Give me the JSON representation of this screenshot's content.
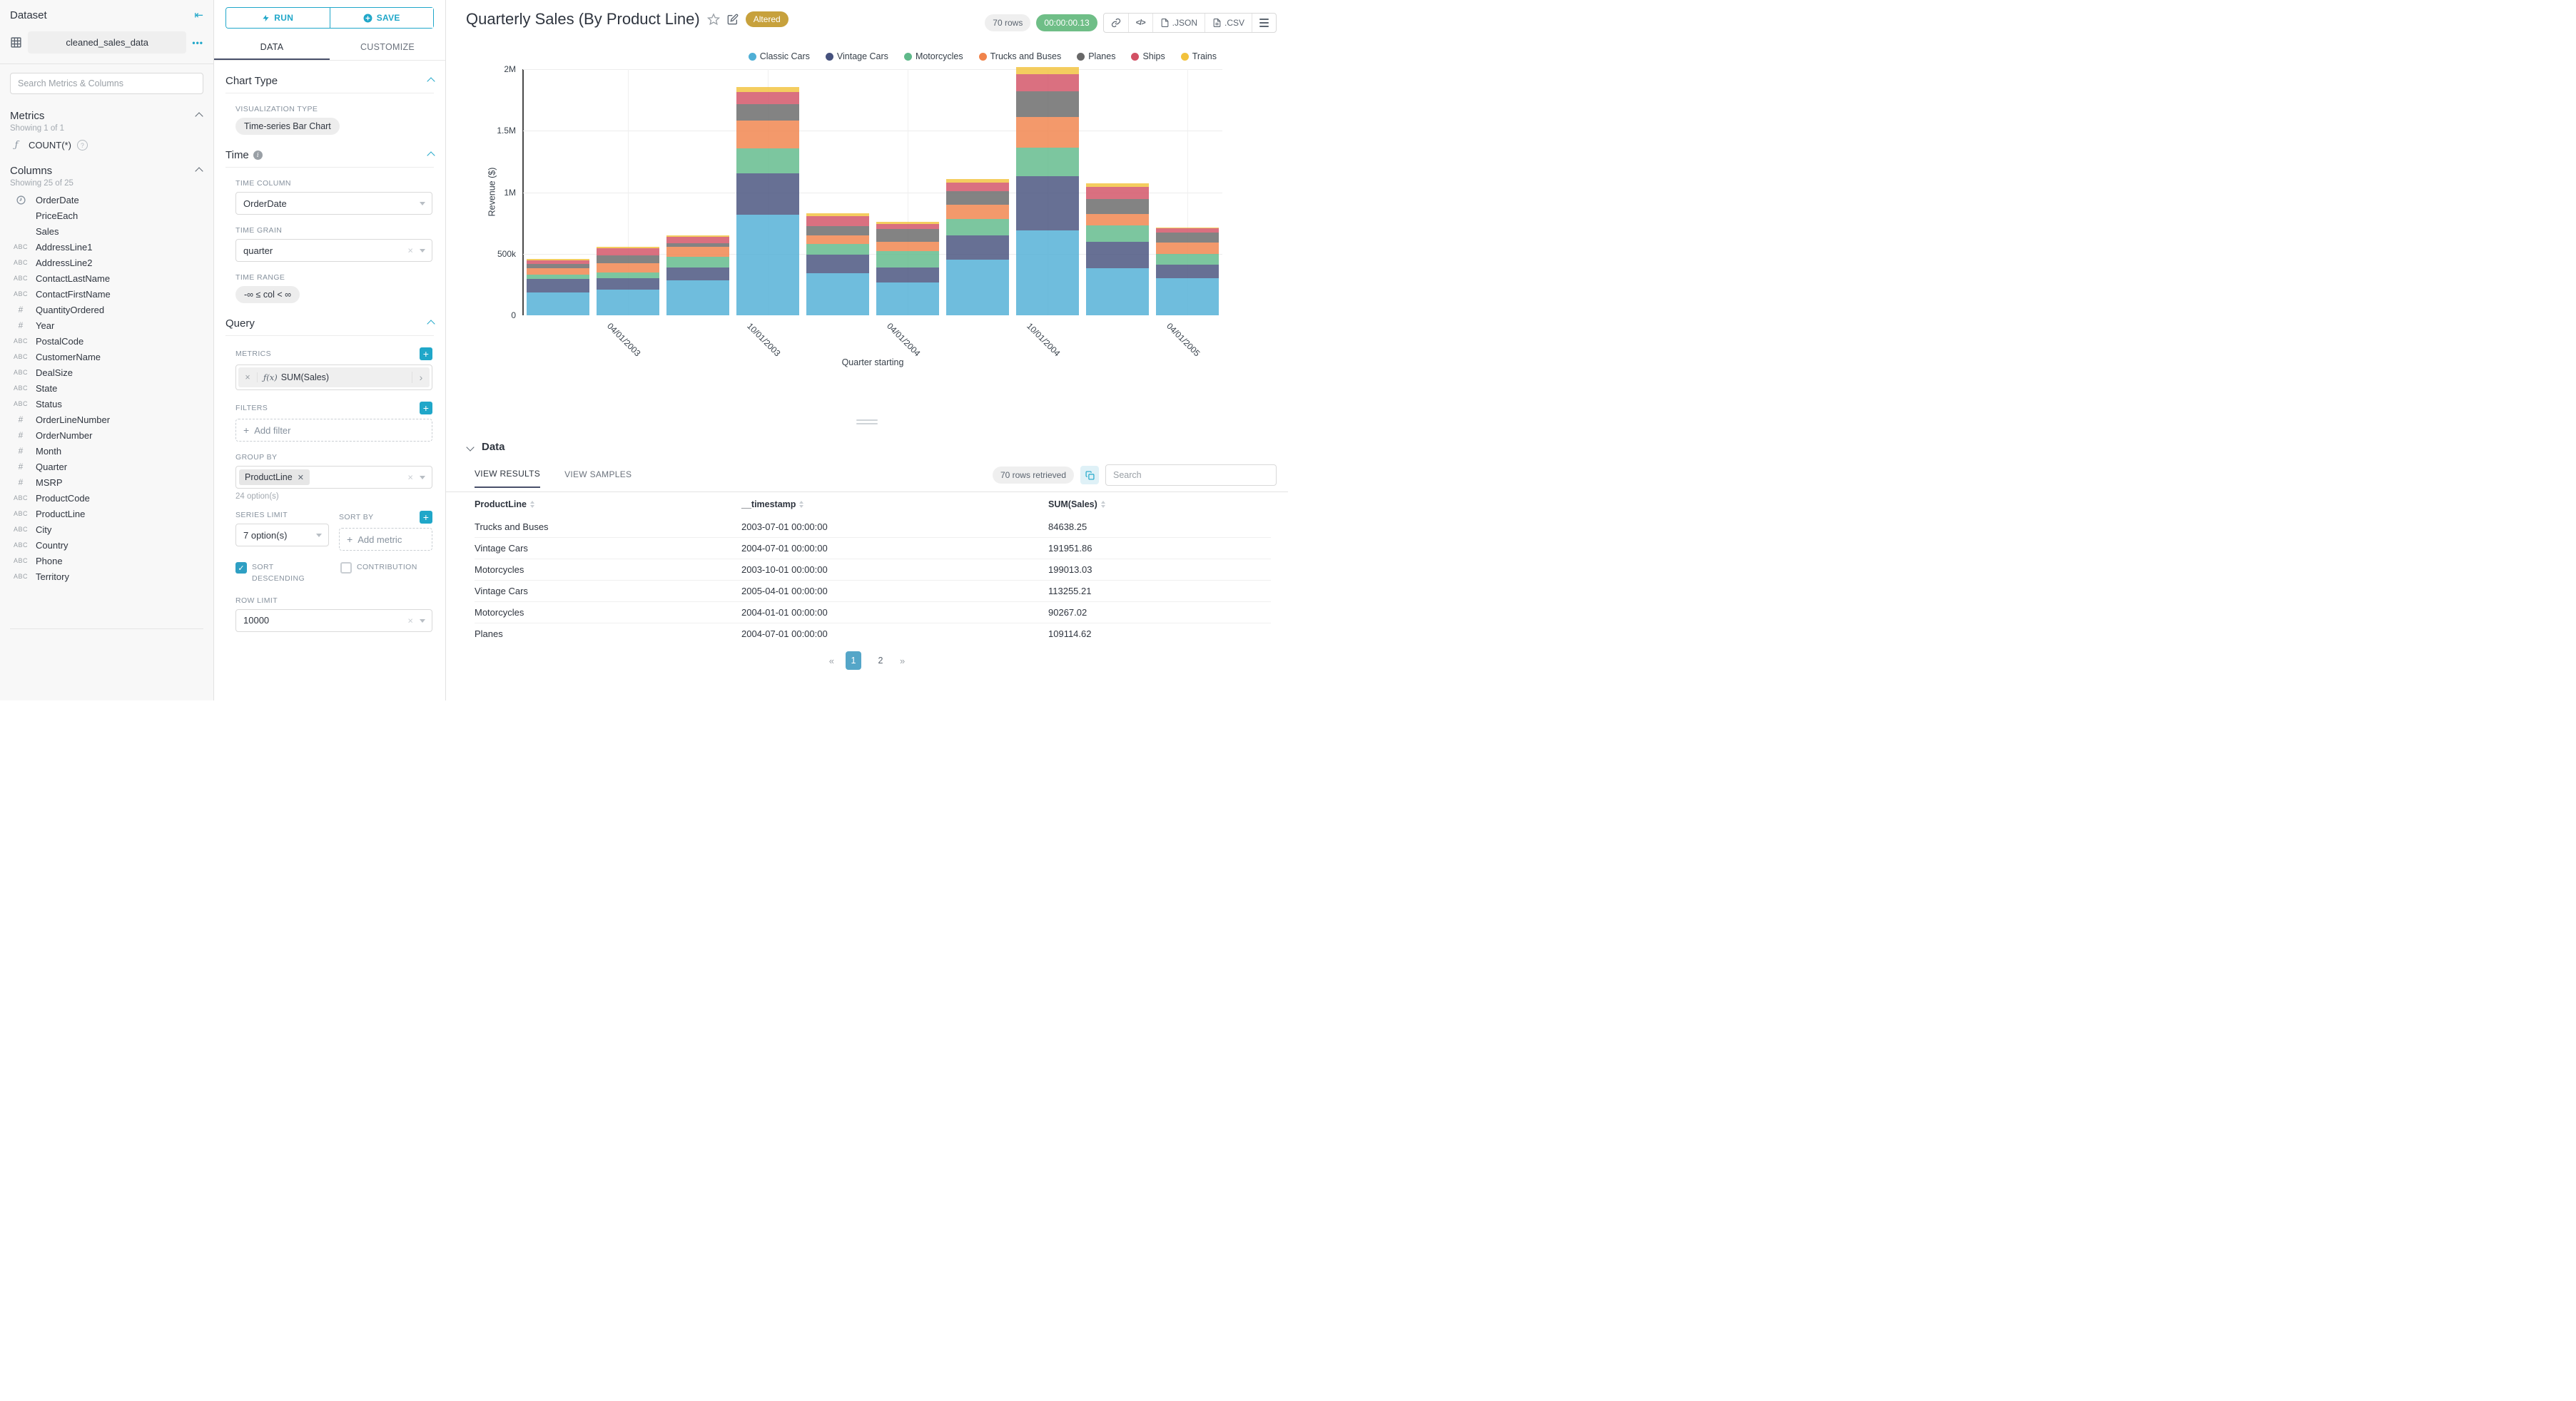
{
  "colors": {
    "accent_teal": "#20a7c9",
    "tab_underline": "#484f69",
    "altered_badge": "#c7a13c",
    "runtime_badge": "#6fbe87",
    "active_page": "#55a6c8",
    "sidebar_bg": "#f8f8f8"
  },
  "sidebar": {
    "title": "Dataset",
    "dataset_name": "cleaned_sales_data",
    "menu_dots": "•••",
    "search_placeholder": "Search Metrics & Columns",
    "metrics_header": "Metrics",
    "metrics_count": "Showing 1 of 1",
    "metric_fx": "ƒ",
    "metric_name": "COUNT(*)",
    "columns_header": "Columns",
    "columns_count": "Showing 25 of 25",
    "type_icons": {
      "text": "ABC",
      "num": "#"
    },
    "columns": [
      {
        "name": "OrderDate",
        "type": "time"
      },
      {
        "name": "PriceEach",
        "type": "none"
      },
      {
        "name": "Sales",
        "type": "none"
      },
      {
        "name": "AddressLine1",
        "type": "text"
      },
      {
        "name": "AddressLine2",
        "type": "text"
      },
      {
        "name": "ContactLastName",
        "type": "text"
      },
      {
        "name": "ContactFirstName",
        "type": "text"
      },
      {
        "name": "QuantityOrdered",
        "type": "num"
      },
      {
        "name": "Year",
        "type": "num"
      },
      {
        "name": "PostalCode",
        "type": "text"
      },
      {
        "name": "CustomerName",
        "type": "text"
      },
      {
        "name": "DealSize",
        "type": "text"
      },
      {
        "name": "State",
        "type": "text"
      },
      {
        "name": "Status",
        "type": "text"
      },
      {
        "name": "OrderLineNumber",
        "type": "num"
      },
      {
        "name": "OrderNumber",
        "type": "num"
      },
      {
        "name": "Month",
        "type": "num"
      },
      {
        "name": "Quarter",
        "type": "num"
      },
      {
        "name": "MSRP",
        "type": "num"
      },
      {
        "name": "ProductCode",
        "type": "text"
      },
      {
        "name": "ProductLine",
        "type": "text"
      },
      {
        "name": "City",
        "type": "text"
      },
      {
        "name": "Country",
        "type": "text"
      },
      {
        "name": "Phone",
        "type": "text"
      },
      {
        "name": "Territory",
        "type": "text"
      }
    ]
  },
  "panel": {
    "run_label": "RUN",
    "save_label": "SAVE",
    "tab_data": "DATA",
    "tab_customize": "CUSTOMIZE",
    "chart_type_header": "Chart Type",
    "visualization_type_label": "VISUALIZATION TYPE",
    "visualization_type": "Time-series Bar Chart",
    "time_header": "Time",
    "time_column_label": "TIME COLUMN",
    "time_column": "OrderDate",
    "time_grain_label": "TIME GRAIN",
    "time_grain": "quarter",
    "time_range_label": "TIME RANGE",
    "time_range": "-∞ ≤ col < ∞",
    "query_header": "Query",
    "metrics_label": "METRICS",
    "metric_prefix": "ƒ(x)",
    "metric_pill": "SUM(Sales)",
    "filters_label": "FILTERS",
    "add_filter": "Add filter",
    "group_by_label": "GROUP BY",
    "group_by_value": "ProductLine",
    "group_by_options": "24 option(s)",
    "series_limit_label": "SERIES LIMIT",
    "series_limit": "7 option(s)",
    "sort_by_label": "SORT BY",
    "add_metric": "Add metric",
    "sort_descending_label": "SORT DESCENDING",
    "contribution_label": "CONTRIBUTION",
    "row_limit_label": "ROW LIMIT",
    "row_limit": "10000"
  },
  "header": {
    "title": "Quarterly Sales (By Product Line)",
    "altered_badge": "Altered",
    "rows_badge": "70 rows",
    "runtime_badge": "00:00:00.13",
    "export_json": ".JSON",
    "export_csv": ".CSV"
  },
  "chart_data": {
    "type": "bar",
    "stacked": true,
    "title": "Quarterly Sales (By Product Line)",
    "xlabel": "Quarter starting",
    "ylabel": "Revenue ($)",
    "ylim": [
      0,
      2000000
    ],
    "y_ticks": [
      "0",
      "500k",
      "1M",
      "1.5M",
      "2M"
    ],
    "grid": true,
    "legend_position": "top-right",
    "x": [
      "2003-01-01",
      "2003-04-01",
      "2003-07-01",
      "2003-10-01",
      "2004-01-01",
      "2004-04-01",
      "2004-07-01",
      "2004-10-01",
      "2005-01-01",
      "2005-04-01"
    ],
    "x_tick_labels": [
      "",
      "04/01/2003",
      "",
      "10/01/2003",
      "",
      "04/01/2004",
      "",
      "10/01/2004",
      "",
      "04/01/2005"
    ],
    "series": [
      {
        "name": "Classic Cars",
        "color": "#4fafd6",
        "values": [
          183000,
          208000,
          282000,
          820000,
          340000,
          265000,
          455000,
          690000,
          380000,
          300000
        ]
      },
      {
        "name": "Vintage Cars",
        "color": "#45517d",
        "values": [
          114000,
          95000,
          104000,
          335000,
          150000,
          125000,
          191951.86,
          440000,
          220000,
          113255.21
        ]
      },
      {
        "name": "Motorcycles",
        "color": "#5fb98a",
        "values": [
          36000,
          46000,
          87000,
          199013.03,
          90267.02,
          130000,
          135000,
          230000,
          130000,
          87000
        ]
      },
      {
        "name": "Trucks and Buses",
        "color": "#f0834b",
        "values": [
          51000,
          76000,
          84638.25,
          230000,
          70000,
          75000,
          115000,
          250000,
          95000,
          90000
        ]
      },
      {
        "name": "Planes",
        "color": "#686868",
        "values": [
          34000,
          61000,
          27000,
          130000,
          75000,
          105000,
          109114.62,
          210000,
          120000,
          85000
        ]
      },
      {
        "name": "Ships",
        "color": "#d25064",
        "values": [
          26000,
          58000,
          55000,
          100000,
          80000,
          45000,
          75000,
          140000,
          100000,
          30000
        ]
      },
      {
        "name": "Trains",
        "color": "#f2c23c",
        "values": [
          12000,
          15000,
          10000,
          40000,
          25000,
          12000,
          28000,
          55000,
          28000,
          8000
        ]
      }
    ]
  },
  "results": {
    "section_title": "Data",
    "tab_results": "VIEW RESULTS",
    "tab_samples": "VIEW SAMPLES",
    "rows_retrieved": "70 rows retrieved",
    "search_placeholder": "Search",
    "columns": [
      "ProductLine",
      "__timestamp",
      "SUM(Sales)"
    ],
    "rows": [
      {
        "product": "Trucks and Buses",
        "timestamp": "2003-07-01 00:00:00",
        "value": "84638.25"
      },
      {
        "product": "Vintage Cars",
        "timestamp": "2004-07-01 00:00:00",
        "value": "191951.86"
      },
      {
        "product": "Motorcycles",
        "timestamp": "2003-10-01 00:00:00",
        "value": "199013.03"
      },
      {
        "product": "Vintage Cars",
        "timestamp": "2005-04-01 00:00:00",
        "value": "113255.21"
      },
      {
        "product": "Motorcycles",
        "timestamp": "2004-01-01 00:00:00",
        "value": "90267.02"
      },
      {
        "product": "Planes",
        "timestamp": "2004-07-01 00:00:00",
        "value": "109114.62"
      }
    ],
    "pagination": {
      "prev": "«",
      "pages": [
        "1",
        "2"
      ],
      "active": "1",
      "next": "»"
    }
  }
}
